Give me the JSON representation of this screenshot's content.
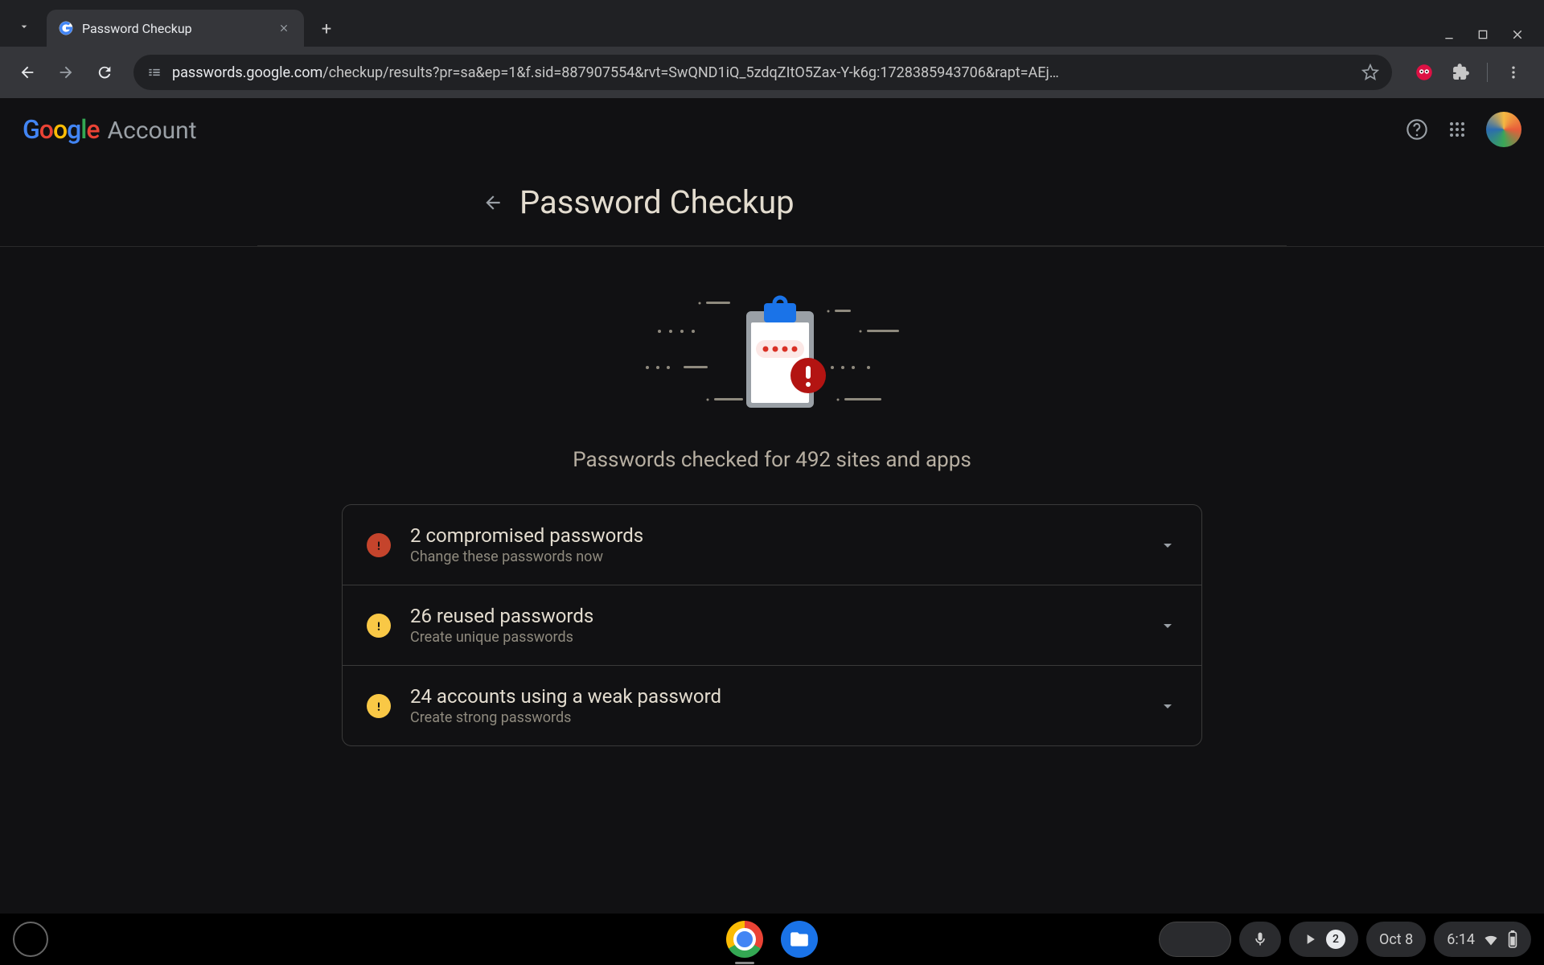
{
  "browser": {
    "tab_title": "Password Checkup",
    "url_domain": "passwords.google.com",
    "url_path": "/checkup/results?pr=sa&ep=1&f.sid=887907554&rvt=SwQND1iQ_5zdqZItO5Zax-Y-k6g:1728385943706&rapt=AEj…"
  },
  "header": {
    "logo_text": "Google",
    "account_text": "Account"
  },
  "page": {
    "title": "Password Checkup",
    "summary_text": "Passwords checked for 492 sites and apps",
    "sites_count": 492,
    "rows": [
      {
        "count": 2,
        "title": "2 compromised passwords",
        "subtitle": "Change these passwords now",
        "severity": "red"
      },
      {
        "count": 26,
        "title": "26 reused passwords",
        "subtitle": "Create unique passwords",
        "severity": "yellow"
      },
      {
        "count": 24,
        "title": "24 accounts using a weak password",
        "subtitle": "Create strong passwords",
        "severity": "yellow"
      }
    ]
  },
  "shelf": {
    "notification_count": "2",
    "date": "Oct 8",
    "time": "6:14"
  }
}
